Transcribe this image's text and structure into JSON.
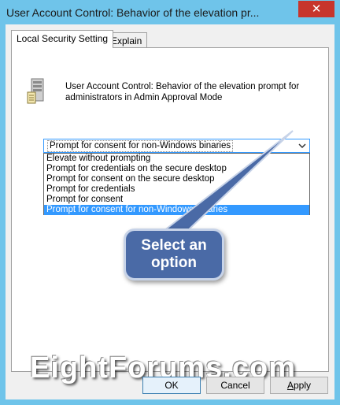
{
  "window": {
    "title": "User Account Control: Behavior of the elevation pr...",
    "close_label": "✕"
  },
  "tabs": [
    {
      "label": "Local Security Setting",
      "active": true
    },
    {
      "label": "Explain",
      "active": false
    }
  ],
  "policy": {
    "description": "User Account Control: Behavior of the elevation prompt for administrators in Admin Approval Mode",
    "icon": "server-policy-icon"
  },
  "select": {
    "current_value": "Prompt for consent for non-Windows binaries",
    "options": [
      "Elevate without prompting",
      "Prompt for credentials on the secure desktop",
      "Prompt for consent on the secure desktop",
      "Prompt for credentials",
      "Prompt for consent",
      "Prompt for consent for non-Windows binaries"
    ],
    "selected_index": 5
  },
  "callout": {
    "line1": "Select an",
    "line2": "option"
  },
  "watermark": "EightForums.com",
  "buttons": {
    "ok": "OK",
    "cancel": "Cancel",
    "apply_prefix": "",
    "apply_underlined": "A",
    "apply_rest": "pply"
  },
  "colors": {
    "window_frame": "#6fc4ea",
    "close_button": "#c7352c",
    "selection": "#3399ff",
    "callout_fill": "#4a6aa6"
  }
}
